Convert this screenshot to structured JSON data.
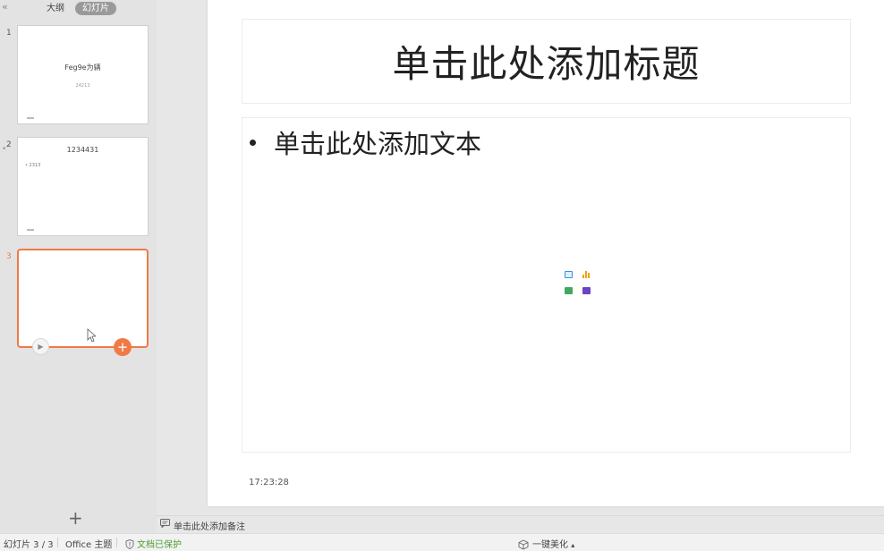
{
  "left_panel": {
    "collapse_glyph": "«",
    "tabs": [
      {
        "label": "大纲",
        "active": false
      },
      {
        "label": "幻灯片",
        "active": true
      }
    ],
    "thumbnails": [
      {
        "number": "1",
        "title": "Feg9e为辆",
        "subtitle": "24213",
        "bullet": ""
      },
      {
        "number": "2",
        "title": "1234431",
        "subtitle": "",
        "bullet": "• 2313",
        "mark": "*"
      },
      {
        "number": "3",
        "title": "",
        "subtitle": "",
        "bullet": "",
        "active": true
      }
    ],
    "add_slide_glyph": "+",
    "thumb_add_glyph": "+",
    "play_glyph": "▶"
  },
  "slide": {
    "title_placeholder": "单击此处添加标题",
    "body_placeholder": "单击此处添加文本",
    "time": "17:23:28",
    "insert_icons": [
      "picture-icon",
      "chart-icon",
      "table-icon",
      "media-icon"
    ]
  },
  "notes": {
    "placeholder": "单击此处添加备注"
  },
  "status_bar": {
    "slide_counter": "幻灯片 3 / 3",
    "theme": "Office 主题",
    "protection": "文档已保护",
    "beautify": "一键美化",
    "beautify_caret": "▴"
  },
  "colors": {
    "accent": "#f07a45",
    "protect": "#4d9c2f"
  }
}
